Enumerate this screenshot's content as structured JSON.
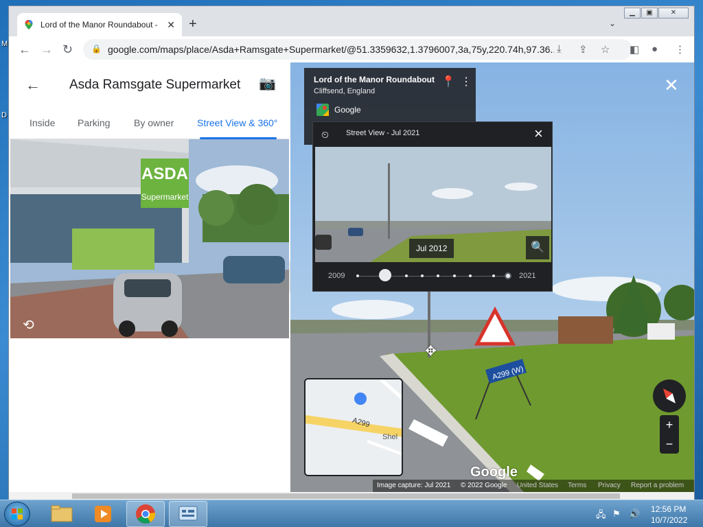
{
  "browser": {
    "tab_title": "Lord of the Manor Roundabout -",
    "url": "google.com/maps/place/Asda+Ramsgate+Supermarket/@51.3359632,1.3796007,3a,75y,220.74h,97.36...",
    "icons": [
      "back-arrow-icon",
      "forward-arrow-icon",
      "reload-icon",
      "lock-icon",
      "install-icon",
      "share-icon",
      "star-icon",
      "side-panel-icon",
      "profile-icon",
      "menu-dots-icon"
    ]
  },
  "panel": {
    "title": "Asda Ramsgate Supermarket",
    "tabs": [
      {
        "label": "Inside",
        "active": false
      },
      {
        "label": "Parking",
        "active": false
      },
      {
        "label": "By owner",
        "active": false
      },
      {
        "label": "Street View & 360°",
        "active": true
      }
    ],
    "photo_sign_text": "ASDA",
    "photo_sign_sub": "Supermarket"
  },
  "street_view": {
    "info_card": {
      "title": "Lord of the Manor Roundabout",
      "subtitle": "Cliffsend, England",
      "provider": "Google"
    },
    "time_machine": {
      "title": "Street View - Jul 2021",
      "selected_date": "Jul 2012",
      "range_start": "2009",
      "range_end": "2021"
    },
    "minimap": {
      "road_label": "A299",
      "place_label": "Shel"
    },
    "road_sign": "A299 (W)",
    "watermark": "Google",
    "attribution": {
      "capture": "Image capture: Jul 2021",
      "copyright": "© 2022 Google",
      "region": "United States",
      "terms": "Terms",
      "privacy": "Privacy",
      "report": "Report a problem"
    },
    "zoom_in": "+",
    "zoom_out": "−"
  },
  "taskbar": {
    "time": "12:56 PM",
    "date": "10/7/2022"
  },
  "colors": {
    "accent": "#1a73e8",
    "asda_green": "#6cb33f"
  }
}
